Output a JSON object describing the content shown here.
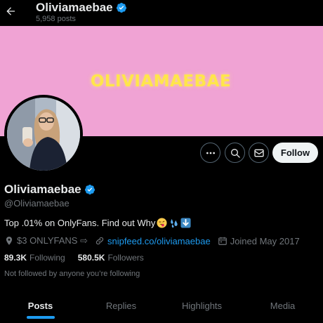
{
  "header": {
    "title": "Oliviamaebae",
    "subtitle": "5,958 posts",
    "back_icon": "arrow-left-icon"
  },
  "banner": {
    "text": "OLIVIAMAEBAE",
    "background_color": "#f0a3d4",
    "text_color": "#ffe64a"
  },
  "profile": {
    "display_name": "Oliviamaebae",
    "handle": "@Oliviamaebae",
    "verified": true,
    "verified_color": "#1d9bf0",
    "bio": "Top .01% on OnlyFans. Find out Why",
    "bio_emojis": [
      "winking-tongue-face-emoji",
      "sweat-droplets-emoji",
      "down-arrow-emoji"
    ],
    "location": "$3 ONLYFANS ⇨",
    "website": "snipfeed.co/oliviamaebae",
    "joined": "Joined May 2017",
    "following_count": "89.3K",
    "following_label": "Following",
    "followers_count": "580.5K",
    "followers_label": "Followers",
    "followed_by": "Not followed by anyone you’re following"
  },
  "actions": {
    "more_icon": "more-horizontal-icon",
    "search_icon": "search-icon",
    "message_icon": "mail-icon",
    "follow_label": "Follow"
  },
  "tabs": [
    {
      "label": "Posts",
      "active": true
    },
    {
      "label": "Replies",
      "active": false
    },
    {
      "label": "Highlights",
      "active": false
    },
    {
      "label": "Media",
      "active": false
    }
  ],
  "colors": {
    "accent": "#1d9bf0",
    "background": "#000000",
    "secondary_text": "#71767b"
  }
}
